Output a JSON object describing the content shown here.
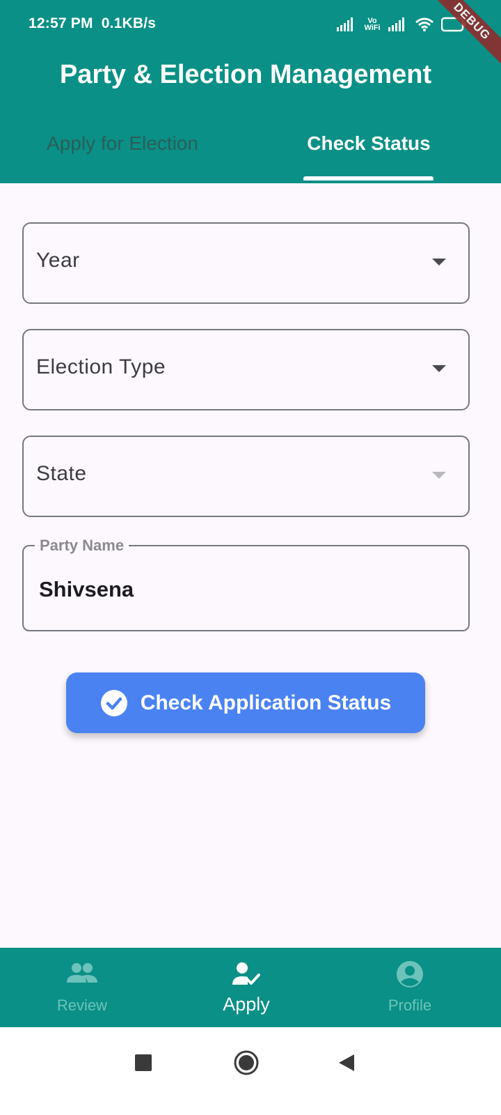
{
  "status_bar": {
    "time": "12:57 PM",
    "network_speed": "0.1KB/s",
    "vowifi_top": "Vo",
    "vowifi_bottom": "WiFi",
    "debug_banner": "DEBUG"
  },
  "app_bar": {
    "title": "Party & Election Management",
    "tabs": [
      {
        "label": "Apply for Election",
        "selected": false
      },
      {
        "label": "Check Status",
        "selected": true
      }
    ]
  },
  "form": {
    "year_dropdown": {
      "label": "Year",
      "icon": "arrow-drop-down-icon"
    },
    "election_type_dropdown": {
      "label": "Election Type",
      "icon": "arrow-drop-down-icon"
    },
    "state_dropdown": {
      "label": "State",
      "icon": "arrow-drop-down-icon",
      "enabled": false
    },
    "party_name": {
      "label": "Party Name",
      "value": "Shivsena"
    }
  },
  "check_button": {
    "label": "Check Application Status",
    "icon": "check-circle-icon"
  },
  "bottom_nav": {
    "items": [
      {
        "label": "Review",
        "icon": "people-icon",
        "active": false
      },
      {
        "label": "Apply",
        "icon": "person-check-icon",
        "active": true
      },
      {
        "label": "Profile",
        "icon": "account-circle-icon",
        "active": false
      }
    ]
  },
  "colors": {
    "primary": "#0a9086",
    "button": "#4a82f2",
    "background": "#fdf8fd",
    "nav_inactive": "#6dc3bb"
  }
}
